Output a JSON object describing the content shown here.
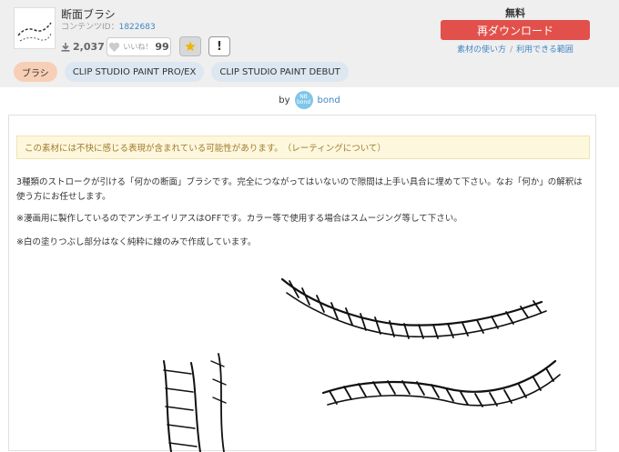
{
  "item": {
    "title": "断面ブラシ",
    "content_id_label": "コンテンツID：",
    "content_id": "1822683",
    "downloads": "2,037",
    "like_label": "いいね！",
    "like_count": "99"
  },
  "purchase": {
    "price": "無料",
    "redownload_label": "再ダウンロード",
    "link_usage": "素材の使い方",
    "link_terms": "利用できる範囲"
  },
  "tags": [
    "ブラシ",
    "CLIP STUDIO PAINT PRO/EX",
    "CLIP STUDIO PAINT DEBUT"
  ],
  "author": {
    "by": "by",
    "name": "bond"
  },
  "warning": {
    "text": "この素材には不快に感じる表現が含まれている可能性があります。",
    "link": "（レーティングについて）"
  },
  "description": {
    "p1": "3種類のストロークが引ける「何かの断面」ブラシです。完全につながってはいないので隙間は上手い具合に埋めて下さい。なお「何か」の解釈は使う方にお任せします。",
    "p2": "※漫画用に製作しているのでアンチエイリアスはOFFです。カラー等で使用する場合はスムージング等して下さい。",
    "p3": "※白の塗りつぶし部分はなく純粋に線のみで作成しています。"
  },
  "colors": {
    "accent_red": "#e2504b",
    "link_blue": "#3f86c6",
    "tag_brush": "#f7cfb6",
    "tag_app": "#dde7f1",
    "warning_bg": "#fdf7dd"
  },
  "icons": {
    "download": "download-icon",
    "heart": "heart-icon",
    "star": "star-icon",
    "report": "exclamation-icon"
  }
}
